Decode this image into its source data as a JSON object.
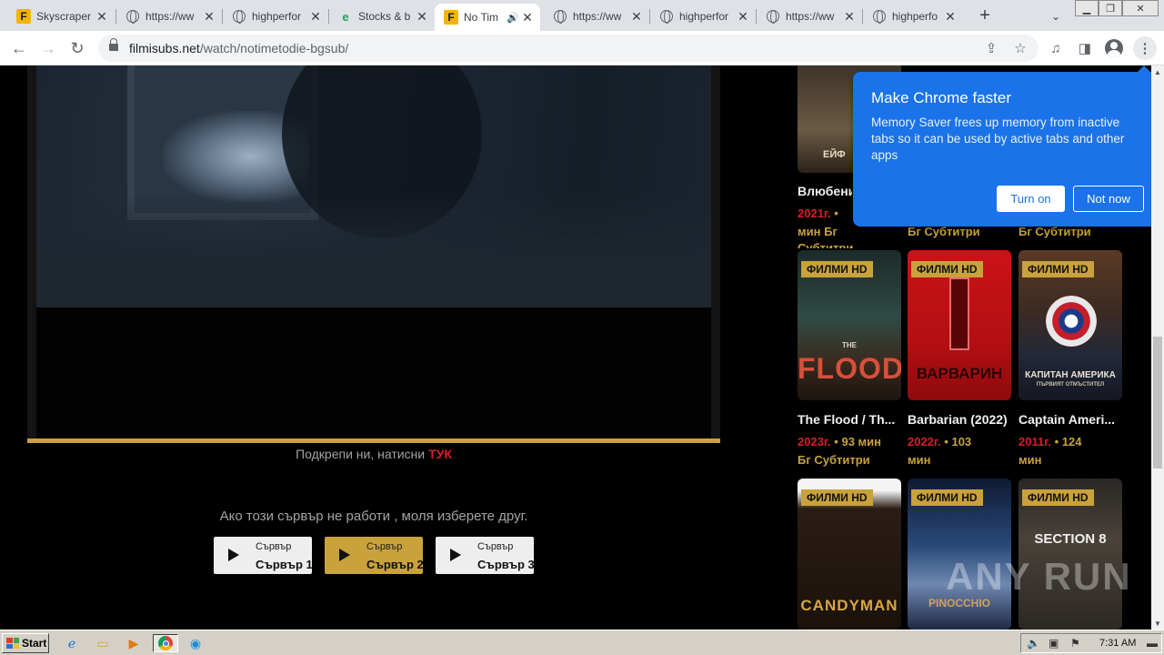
{
  "browser": {
    "tabs": [
      {
        "title": "Skyscraper",
        "icon": "filmisubs-f-icon"
      },
      {
        "title": "https://ww",
        "icon": "globe-icon"
      },
      {
        "title": "highperfor",
        "icon": "globe-icon"
      },
      {
        "title": "Stocks & b",
        "icon": "stocks-e-icon"
      },
      {
        "title": "No Tim",
        "icon": "filmisubs-f-icon",
        "active": true,
        "audio": true
      },
      {
        "title": "https://ww",
        "icon": "globe-icon"
      },
      {
        "title": "highperfor",
        "icon": "globe-icon"
      },
      {
        "title": "https://ww",
        "icon": "globe-icon"
      },
      {
        "title": "highperfo",
        "icon": "globe-icon"
      }
    ],
    "url_domain": "filmisubs.net",
    "url_path": "/watch/notimetodie-bgsub/"
  },
  "page": {
    "support_text": "Подкрепи ни, натисни",
    "support_link": "ТУК",
    "server_note": "Ако този сървър не работи , моля изберете друг.",
    "servers": [
      {
        "small": "Сървър",
        "big": "Сървър 1"
      },
      {
        "small": "Сървър",
        "big": "Сървър 2",
        "active": true
      },
      {
        "small": "Сървър",
        "big": "Сървър 3"
      }
    ],
    "colors": {
      "accent": "#c9a23c",
      "year": "#d81f26",
      "popup": "#1a73e8"
    }
  },
  "movies": {
    "top_row": {
      "title": "Влюбени",
      "col1_year": "2021г.",
      "col1_bullet": "•",
      "col1_min": "мин",
      "col1_subs": "Бг",
      "col1_subs2": "Субтитри",
      "col2_subs": "Бг Субтитри",
      "col3_subs": "Бг Субтитри",
      "poster_text": "ЕЙФ"
    },
    "badge": "ФИЛМИ HD",
    "row1": [
      {
        "title": "The Flood / Th...",
        "year": "2023г.",
        "dur": "93 мин",
        "subs": "Бг Субтитри",
        "poster_text": "FLOOD",
        "poster_small": "THE"
      },
      {
        "title": "Barbarian (2022)",
        "year": "2022г.",
        "dur": "103",
        "dur2": "мин",
        "poster_text": "ВАРВАРИН"
      },
      {
        "title": "Captain Ameri...",
        "year": "2011г.",
        "dur": "124",
        "dur2": "мин",
        "poster_text": "КАПИТАН АМЕРИКА",
        "poster_small": "ПЪРВИЯТ ОТМЪСТИТЕЛ"
      }
    ],
    "bullet": "•",
    "row2": [
      {
        "poster_text": "CANDYMAN"
      },
      {
        "poster_text": "PINOCCHIO"
      },
      {
        "poster_text": "SECTION 8"
      }
    ]
  },
  "popup": {
    "title": "Make Chrome faster",
    "body": "Memory Saver frees up memory from inactive tabs so it can be used by active tabs and other apps",
    "turn_on": "Turn on",
    "not_now": "Not now"
  },
  "watermark": "ANY RUN",
  "taskbar": {
    "start": "Start",
    "clock": "7:31 AM"
  }
}
